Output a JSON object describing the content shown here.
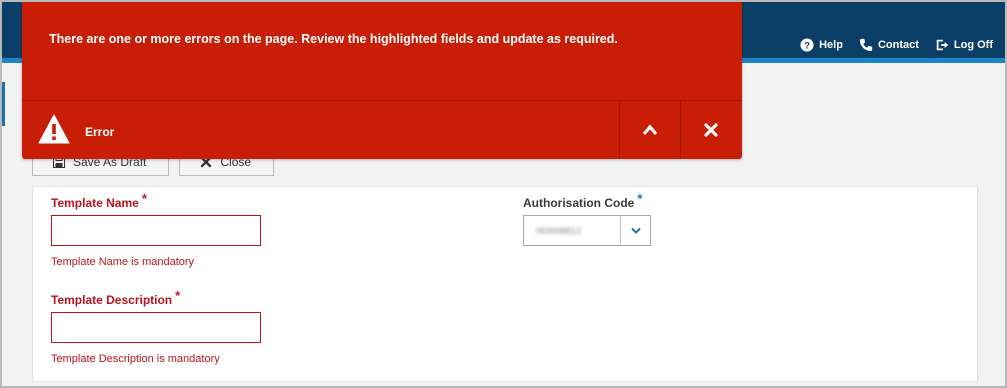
{
  "header": {
    "links": [
      {
        "label": "Help",
        "icon": "help-icon"
      },
      {
        "label": "Contact",
        "icon": "phone-icon"
      },
      {
        "label": "Log Off",
        "icon": "logout-icon"
      }
    ]
  },
  "error_banner": {
    "message": "There are one or more errors on the page. Review the highlighted fields and update as required.",
    "label": "Error",
    "color": "#c81e05"
  },
  "toolbar": {
    "save_draft_label": "Save As Draft",
    "close_label": "Close"
  },
  "form": {
    "template_name": {
      "label": "Template Name",
      "required": "*",
      "value": "",
      "error": "Template Name is mandatory"
    },
    "template_description": {
      "label": "Template Description",
      "required": "*",
      "value": "",
      "error": "Template Description is mandatory"
    },
    "authorisation_code": {
      "label": "Authorisation Code",
      "required": "*",
      "value": "069998812"
    }
  },
  "colors": {
    "header_bg": "#0b3e66",
    "accent": "#1a86c7",
    "error_red": "#b8141c"
  }
}
